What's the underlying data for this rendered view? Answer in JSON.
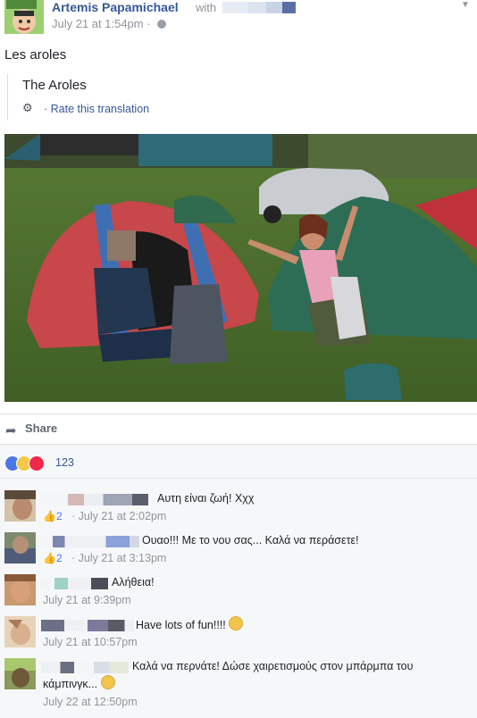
{
  "header": {
    "author": "Artemis Papamichael",
    "with_text": "with",
    "timestamp": "July 21 at 1:54pm ·"
  },
  "post": {
    "text": "Les aroles",
    "translation": "The Aroles",
    "rate_translation": "· Rate this translation"
  },
  "actions": {
    "share_label": "Share"
  },
  "reactions": {
    "count": "123"
  },
  "comments": [
    {
      "text": "Αυτη είναι ζωή! Χχχ",
      "likes": "2",
      "time": "· July 21 at 2:02pm"
    },
    {
      "text": "Ουαο!!! Με το νου σας... Καλά να περάσετε!",
      "likes": "2",
      "time": "· July 21 at 3:13pm"
    },
    {
      "text": "Αλήθεια!",
      "time": "July 21 at 9:39pm"
    },
    {
      "text": "Have lots of fun!!!!",
      "time": "July 21 at 10:57pm"
    },
    {
      "text_line1": "Καλά να περνάτε! Δώσε χαιρετισμούς στον μπάρμπα του",
      "text_line2": "κάμπινγκ...",
      "time": "July 22 at 12:50pm"
    }
  ]
}
